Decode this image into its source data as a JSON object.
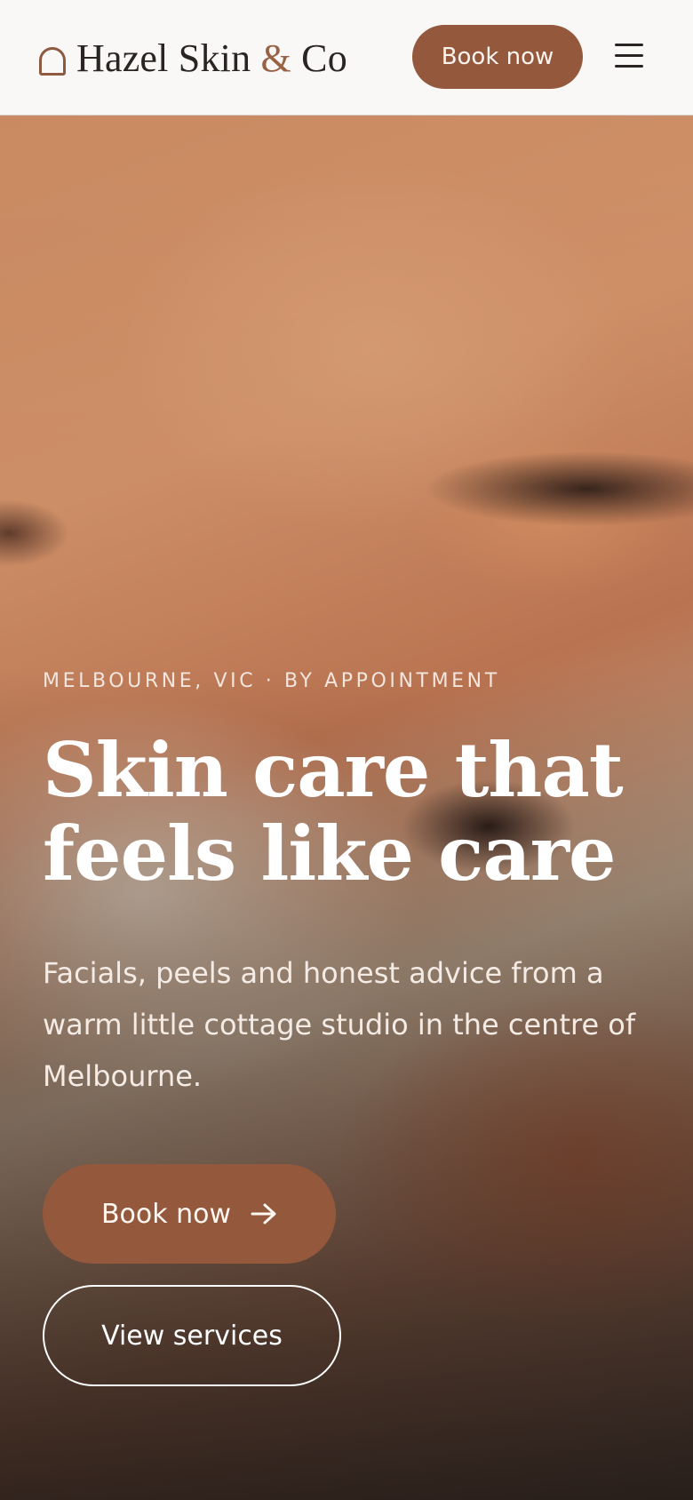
{
  "header": {
    "brand_name": "Hazel Skin",
    "brand_amp": "&",
    "brand_suffix": "Co",
    "book_label": "Book now",
    "menu_icon": "hamburger-menu-icon"
  },
  "hero": {
    "eyebrow": "MELBOURNE, VIC · BY APPOINTMENT",
    "headline": "Skin care that feels like care",
    "subcopy": "Facials, peels and honest advice from a warm little cottage studio in the centre of Melbourne.",
    "primary_cta": "Book now",
    "primary_cta_icon": "arrow-right-icon",
    "secondary_cta": "View services"
  },
  "colors": {
    "accent": "#94583d",
    "header_bg": "#f9f8f7",
    "text_dark": "#2a2522"
  }
}
